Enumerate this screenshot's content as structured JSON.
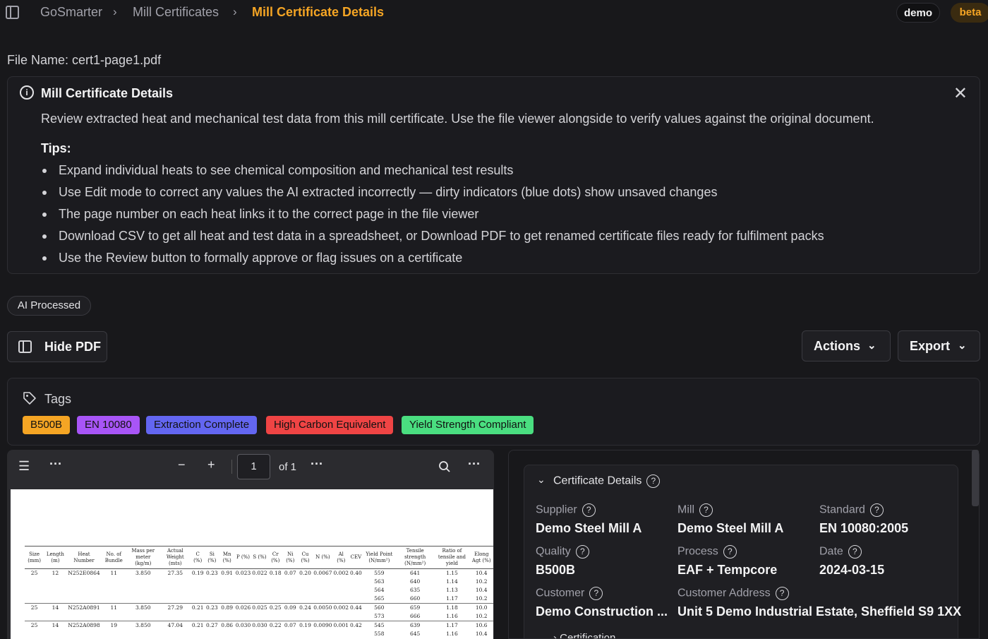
{
  "breadcrumb": [
    "GoSmarter",
    "Mill Certificates",
    "Mill Certificate Details"
  ],
  "user_badge": "demo",
  "beta_badge": "beta",
  "file_name": "File Name: cert1-page1.pdf",
  "info": {
    "title": "Mill Certificate Details",
    "description": "Review extracted heat and mechanical test data from this mill certificate. Use the file viewer alongside to verify values against the original document.",
    "tips_title": "Tips:",
    "tips": [
      "Expand individual heats to see chemical composition and mechanical test results",
      "Use Edit mode to correct any values the AI extracted incorrectly — dirty indicators (blue dots) show unsaved changes",
      "The page number on each heat links it to the correct page in the file viewer",
      "Download CSV to get all heat and test data in a spreadsheet, or Download PDF to get renamed certificate files ready for fulfilment packs",
      "Use the Review button to formally approve or flag issues on a certificate"
    ]
  },
  "ai_badge": "AI Processed",
  "hide_pdf_label": "Hide PDF",
  "actions_label": "Actions",
  "export_label": "Export",
  "tags": {
    "title": "Tags",
    "items": [
      {
        "label": "B500B",
        "color": "#f5a524"
      },
      {
        "label": "EN 10080",
        "color": "#a855f7"
      },
      {
        "label": "Extraction Complete",
        "color": "#6366f1"
      },
      {
        "label": "High Carbon Equivalent",
        "color": "#ef4444"
      },
      {
        "label": "Yield Strength Compliant",
        "color": "#4ade80"
      }
    ]
  },
  "pdf_toolbar": {
    "page": "1",
    "of": "of 1"
  },
  "pdf_table": {
    "headers": [
      "Size (mm)",
      "Length (m)",
      "Heat Number",
      "No. of Bundle",
      "Mass per meter (kg/m)",
      "Actual Weight (mts)",
      "C (%)",
      "Si (%)",
      "Mn (%)",
      "P (%)",
      "S (%)",
      "Cr (%)",
      "Ni (%)",
      "Cu (%)",
      "N (%)",
      "Al (%)",
      "CEV",
      "Yield Point (N/mm²)",
      "Tensile strength (N/mm²)",
      "Ratio of tensile and yield",
      "Elong Agt (%)"
    ],
    "rows": [
      [
        "25",
        "12",
        "N252E0864",
        "11",
        "3.850",
        "27.35",
        "0.19",
        "0.23",
        "0.91",
        "0.023",
        "0.022",
        "0.18",
        "0.07",
        "0.20",
        "0.0067",
        "0.002",
        "0.40",
        "559",
        "641",
        "1.15",
        "10.4"
      ],
      [
        "",
        "",
        "",
        "",
        "",
        "",
        "",
        "",
        "",
        "",
        "",
        "",
        "",
        "",
        "",
        "",
        "",
        "563",
        "640",
        "1.14",
        "10.2"
      ],
      [
        "",
        "",
        "",
        "",
        "",
        "",
        "",
        "",
        "",
        "",
        "",
        "",
        "",
        "",
        "",
        "",
        "",
        "564",
        "635",
        "1.13",
        "10.4"
      ],
      [
        "",
        "",
        "",
        "",
        "",
        "",
        "",
        "",
        "",
        "",
        "",
        "",
        "",
        "",
        "",
        "",
        "",
        "565",
        "660",
        "1.17",
        "10.2"
      ],
      [
        "25",
        "14",
        "N252A0891",
        "11",
        "3.850",
        "27.29",
        "0.21",
        "0.23",
        "0.89",
        "0.026",
        "0.025",
        "0.25",
        "0.09",
        "0.24",
        "0.0050",
        "0.002",
        "0.44",
        "560",
        "659",
        "1.18",
        "10.0"
      ],
      [
        "",
        "",
        "",
        "",
        "",
        "",
        "",
        "",
        "",
        "",
        "",
        "",
        "",
        "",
        "",
        "",
        "",
        "573",
        "666",
        "1.16",
        "10.2"
      ],
      [
        "25",
        "14",
        "N252A0898",
        "19",
        "3.850",
        "47.04",
        "0.21",
        "0.27",
        "0.86",
        "0.030",
        "0.030",
        "0.22",
        "0.07",
        "0.19",
        "0.0090",
        "0.001",
        "0.42",
        "545",
        "639",
        "1.17",
        "10.6"
      ],
      [
        "",
        "",
        "",
        "",
        "",
        "",
        "",
        "",
        "",
        "",
        "",
        "",
        "",
        "",
        "",
        "",
        "",
        "558",
        "645",
        "1.16",
        "10.4"
      ]
    ]
  },
  "certificate": {
    "section_title": "Certificate Details",
    "fields": [
      {
        "label": "Supplier",
        "value": "Demo Steel Mill A"
      },
      {
        "label": "Mill",
        "value": "Demo Steel Mill A"
      },
      {
        "label": "Standard",
        "value": "EN 10080:2005"
      },
      {
        "label": "Quality",
        "value": "B500B"
      },
      {
        "label": "Process",
        "value": "EAF + Tempcore"
      },
      {
        "label": "Date",
        "value": "2024-03-15"
      },
      {
        "label": "Customer",
        "value": "Demo Construction ..."
      },
      {
        "label": "Customer Address",
        "value": "Unit 5 Demo Industrial Estate, Sheffield S9 1XX"
      }
    ],
    "subsection": "Certification"
  }
}
